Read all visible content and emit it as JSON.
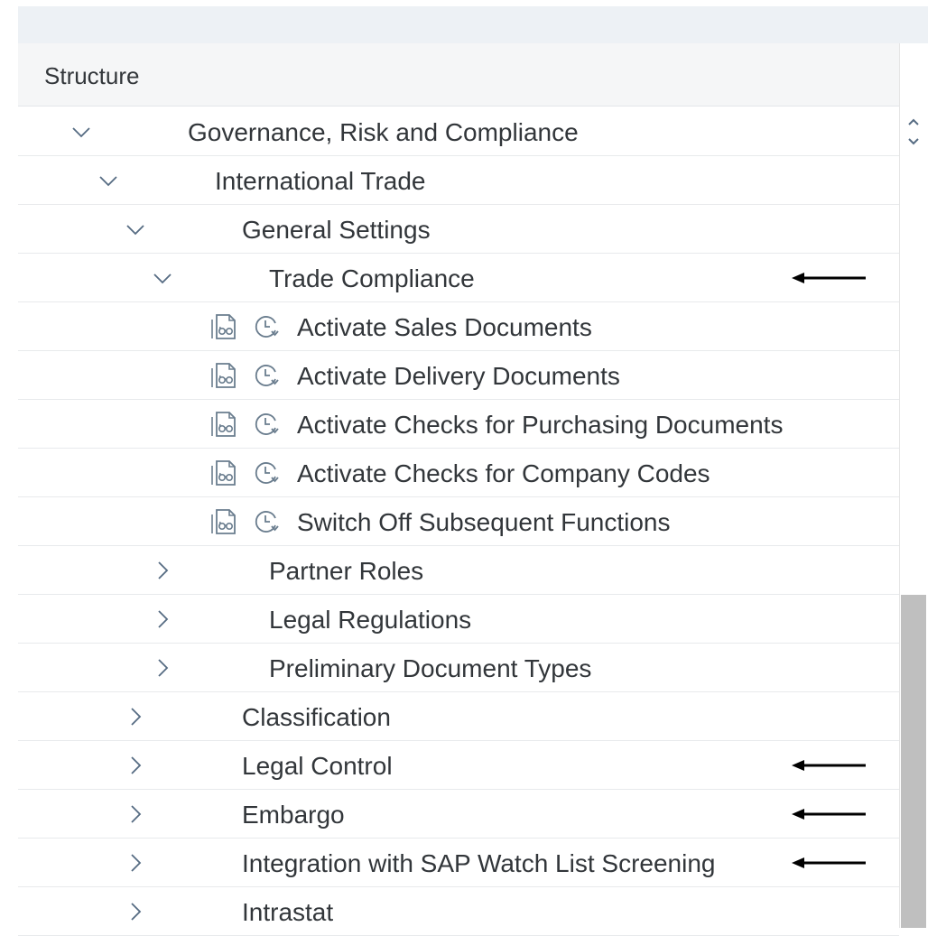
{
  "header": {
    "title": "Structure"
  },
  "tree": [
    {
      "label": "Governance, Risk and Compliance",
      "level": 0,
      "state": "expanded"
    },
    {
      "label": "International Trade",
      "level": 1,
      "state": "expanded"
    },
    {
      "label": "General Settings",
      "level": 2,
      "state": "expanded"
    },
    {
      "label": "Trade Compliance",
      "level": 3,
      "state": "expanded",
      "marked": true
    },
    {
      "label": "Activate Sales Documents",
      "level": 4,
      "state": "leaf"
    },
    {
      "label": "Activate Delivery Documents",
      "level": 4,
      "state": "leaf"
    },
    {
      "label": "Activate Checks for Purchasing Documents",
      "level": 4,
      "state": "leaf"
    },
    {
      "label": "Activate Checks for Company Codes",
      "level": 4,
      "state": "leaf"
    },
    {
      "label": "Switch Off Subsequent Functions",
      "level": 4,
      "state": "leaf"
    },
    {
      "label": "Partner Roles",
      "level": 3,
      "state": "collapsed"
    },
    {
      "label": "Legal Regulations",
      "level": 3,
      "state": "collapsed"
    },
    {
      "label": "Preliminary Document Types",
      "level": 3,
      "state": "collapsed"
    },
    {
      "label": "Classification",
      "level": 2,
      "state": "collapsed"
    },
    {
      "label": "Legal Control",
      "level": 2,
      "state": "collapsed",
      "marked": true
    },
    {
      "label": "Embargo",
      "level": 2,
      "state": "collapsed",
      "marked": true
    },
    {
      "label": "Integration with SAP Watch List Screening",
      "level": 2,
      "state": "collapsed",
      "marked": true
    },
    {
      "label": "Intrastat",
      "level": 2,
      "state": "collapsed"
    }
  ],
  "icons": {
    "expanded": "chevron-down-icon",
    "collapsed": "chevron-right-icon",
    "leaf_doc": "document-glasses-icon",
    "leaf_clock": "clock-icon",
    "marker": "arrow-left-icon"
  },
  "colors": {
    "text": "#32363a",
    "header_bg": "#f5f6f7",
    "top_band": "#edf1f5",
    "chevron": "#556b82",
    "icon": "#6a7d8e",
    "scroll_thumb": "#bfbfbf"
  }
}
